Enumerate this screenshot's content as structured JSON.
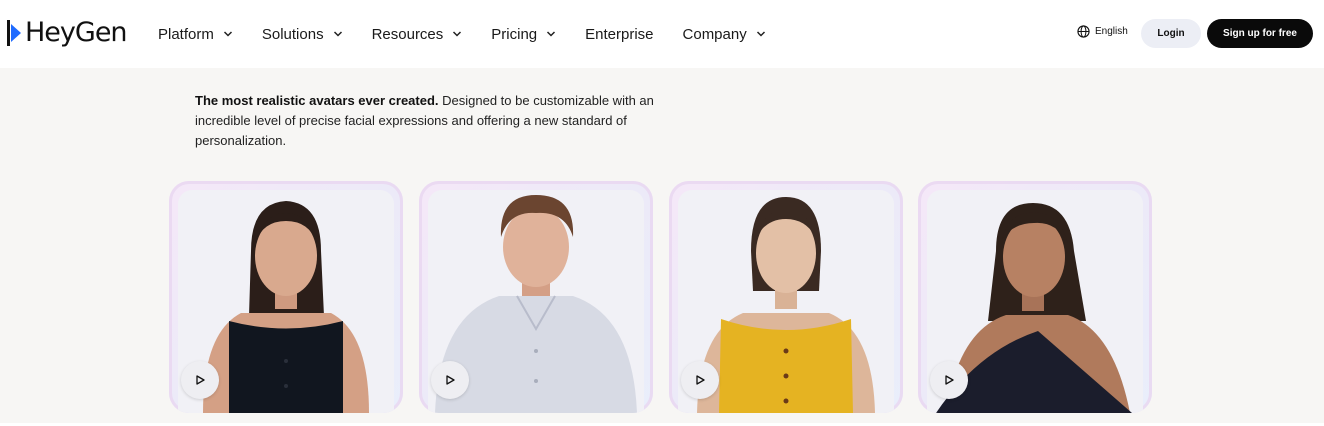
{
  "brand": {
    "name": "HeyGen"
  },
  "nav": {
    "items": [
      {
        "label": "Platform",
        "has_menu": true
      },
      {
        "label": "Solutions",
        "has_menu": true
      },
      {
        "label": "Resources",
        "has_menu": true
      },
      {
        "label": "Pricing",
        "has_menu": true
      },
      {
        "label": "Enterprise",
        "has_menu": false
      },
      {
        "label": "Company",
        "has_menu": true
      }
    ],
    "language": "English",
    "login": "Login",
    "signup": "Sign up for free"
  },
  "intro": {
    "bold": "The most realistic avatars ever created.",
    "text": " Designed to be customizable with an incredible level of precise facial expressions and offering a new standard of personalization."
  },
  "avatars": [
    {
      "icon": "play-icon",
      "hair": "#2b1e19",
      "skin": "#d9a98e",
      "top": "#11161f"
    },
    {
      "icon": "play-icon",
      "hair": "#6b4530",
      "skin": "#e0b29a",
      "top": "#d7dae4"
    },
    {
      "icon": "play-icon",
      "hair": "#3a2a22",
      "skin": "#e3c0a6",
      "top": "#e5b322"
    },
    {
      "icon": "play-icon",
      "hair": "#2e211a",
      "skin": "#b78163",
      "top": "#1b1d2c"
    }
  ],
  "colors": {
    "signup_bg": "#0a0a0a",
    "login_bg": "#eceef5",
    "page_bg": "#f7f6f4"
  }
}
